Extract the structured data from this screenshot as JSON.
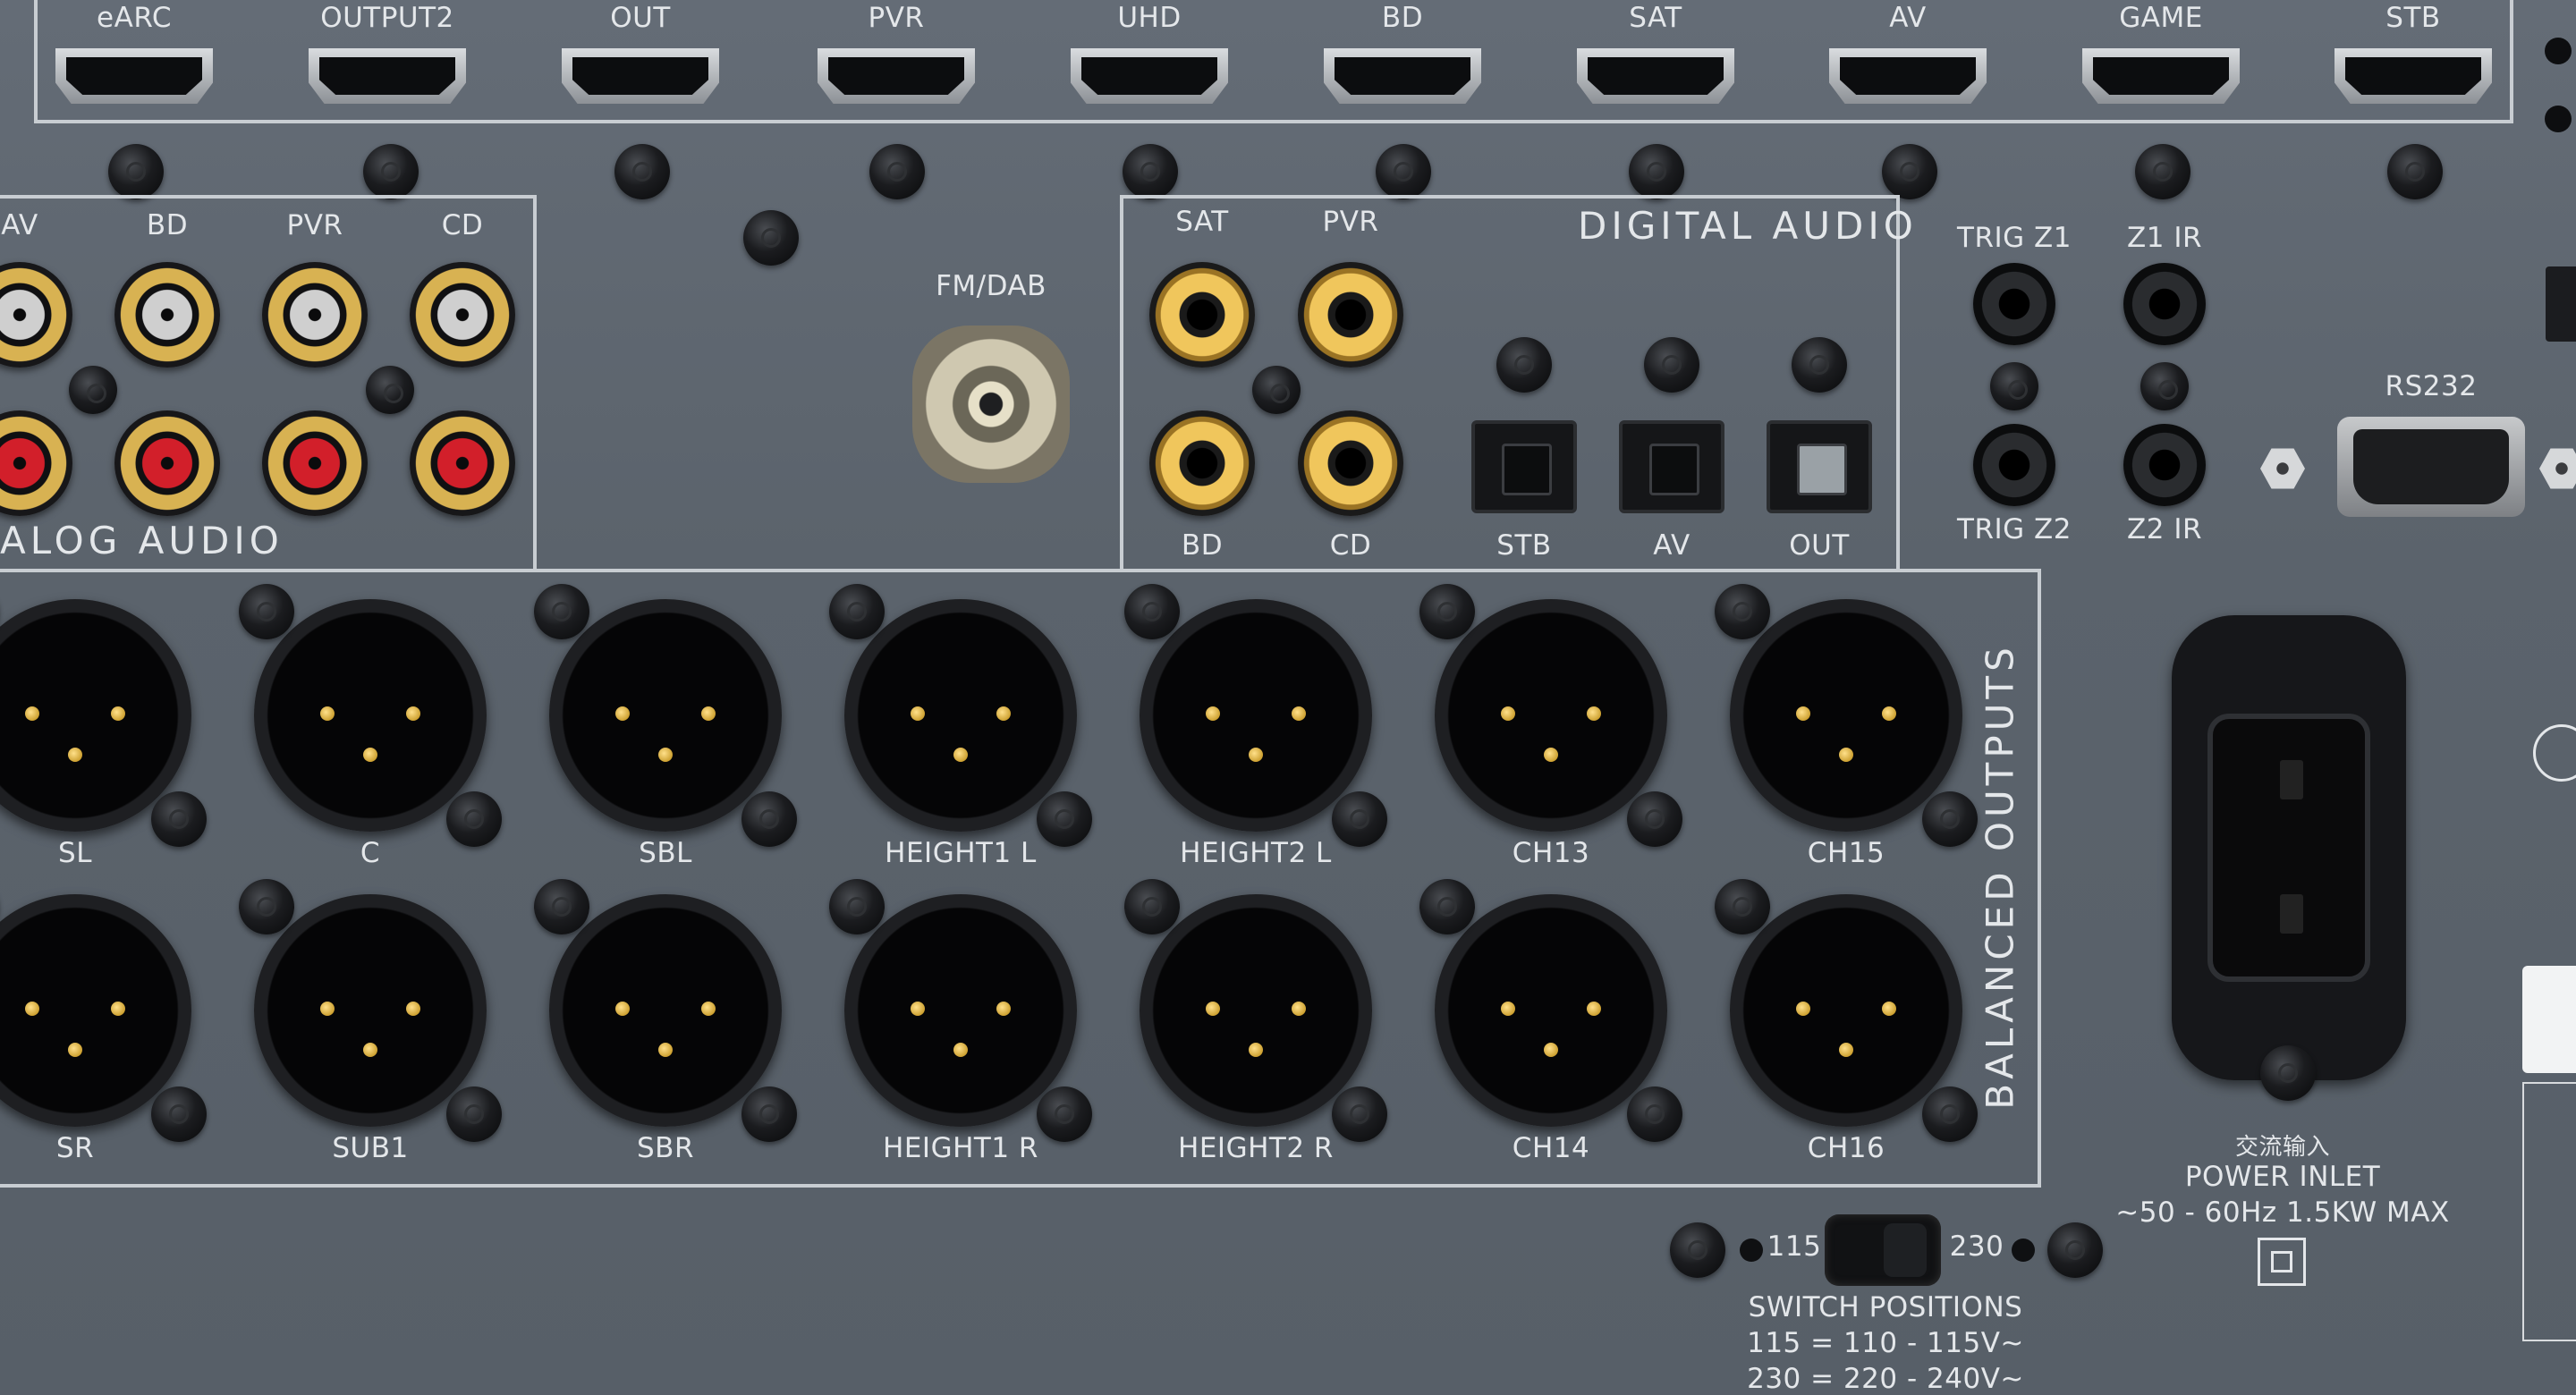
{
  "hdmi": {
    "labels": [
      "eARC",
      "OUTPUT2",
      "OUT",
      "PVR",
      "UHD",
      "BD",
      "SAT",
      "AV",
      "GAME",
      "STB"
    ]
  },
  "analog_audio": {
    "title": "ALOG AUDIO",
    "labels": [
      "AV",
      "BD",
      "PVR",
      "CD"
    ]
  },
  "fm_dab": {
    "label": "FM/DAB"
  },
  "digital_audio": {
    "title": "DIGITAL AUDIO",
    "coax_top": [
      "SAT",
      "PVR"
    ],
    "coax_bottom": [
      "BD",
      "CD"
    ],
    "optical": [
      "STB",
      "AV",
      "OUT"
    ]
  },
  "triggers": {
    "top": [
      "TRIG Z1",
      "Z1 IR"
    ],
    "bottom": [
      "TRIG Z2",
      "Z2 IR"
    ]
  },
  "serial": {
    "label": "RS232"
  },
  "balanced_outputs": {
    "title": "BALANCED OUTPUTS",
    "top": [
      "SL",
      "C",
      "SBL",
      "HEIGHT1 L",
      "HEIGHT2 L",
      "CH13",
      "CH15"
    ],
    "bottom": [
      "SR",
      "SUB1",
      "SBR",
      "HEIGHT1 R",
      "HEIGHT2 R",
      "CH14",
      "CH16"
    ]
  },
  "power": {
    "cjk": "交流输入",
    "label": "POWER INLET",
    "spec": "~50 - 60Hz 1.5KW MAX"
  },
  "voltage_switch": {
    "low": "115",
    "high": "230",
    "title": "SWITCH POSITIONS",
    "line1": "115 = 110 - 115V~",
    "line2": "230 = 220 - 240V~"
  }
}
